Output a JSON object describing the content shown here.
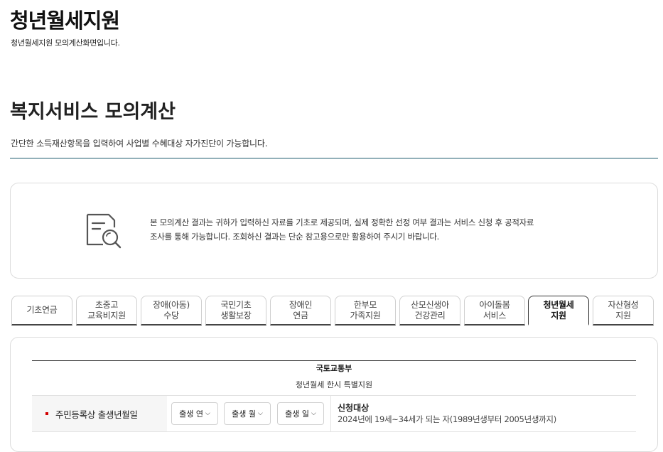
{
  "header": {
    "title": "청년월세지원",
    "subtitle": "청년월세지원 모의계산화면입니다."
  },
  "section": {
    "title": "복지서비스 모의계산",
    "description": "간단한 소득재산항목을 입력하여 사업별 수혜대상 자가진단이 가능합니다."
  },
  "notice": {
    "icon": "document-search-icon",
    "line1": "본 모의계산 결과는 귀하가 입력하신 자료를 기초로 제공되며, 실제 정확한 선정 여부 결과는 서비스 신청 후 공적자료",
    "line2": "조사를 통해 가능합니다. 조회하신 결과는 단순 참고용으로만 활용하여 주시기 바랍니다."
  },
  "tabs": [
    {
      "label": "기초연금",
      "active": false
    },
    {
      "label": "초중고\n교육비지원",
      "active": false
    },
    {
      "label": "장애(아동)\n수당",
      "active": false
    },
    {
      "label": "국민기초\n생활보장",
      "active": false
    },
    {
      "label": "장애인\n연금",
      "active": false
    },
    {
      "label": "한부모\n가족지원",
      "active": false
    },
    {
      "label": "산모신생아\n건강관리",
      "active": false
    },
    {
      "label": "아이돌봄\n서비스",
      "active": false
    },
    {
      "label": "청년월세\n지원",
      "active": true
    },
    {
      "label": "자산형성\n지원",
      "active": false
    }
  ],
  "program": {
    "agency": "국토교통부",
    "name": "청년월세 한시 특별지원"
  },
  "form": {
    "birth_label": "주민등록상 출생년월일",
    "year_select": "출생 연",
    "month_select": "출생 월",
    "day_select": "출생 일",
    "target_title": "신청대상",
    "target_desc": "2024년에 19세~34세가 되는 자(1989년생부터 2005년생까지)"
  },
  "colors": {
    "accent_line": "#1b5a6d",
    "required_mark": "#d20000"
  }
}
